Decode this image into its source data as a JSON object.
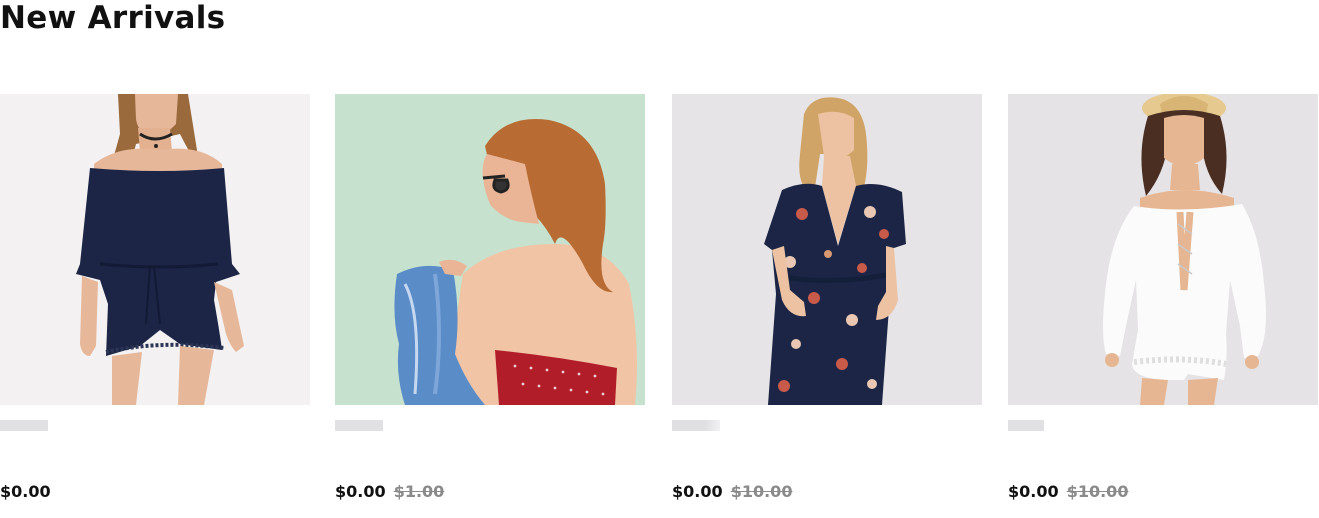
{
  "section": {
    "title": "New Arrivals"
  },
  "products": [
    {
      "image_alt": "off-shoulder navy romper",
      "price": "$0.00",
      "original_price": ""
    },
    {
      "image_alt": "denim jacket red bandeau top",
      "price": "$0.00",
      "original_price": "$1.00"
    },
    {
      "image_alt": "navy floral wrap jumpsuit",
      "price": "$0.00",
      "original_price": "$10.00"
    },
    {
      "image_alt": "white lace off-shoulder romper",
      "price": "$0.00",
      "original_price": "$10.00"
    }
  ],
  "colors": {
    "card1_bg": "#f3f1f1",
    "card2_bg": "#c6e2cf",
    "card3_bg": "#e6e4e6",
    "card4_bg": "#e5e3e5",
    "navy": "#1c2545",
    "strike_price": "#8a8a8a"
  }
}
